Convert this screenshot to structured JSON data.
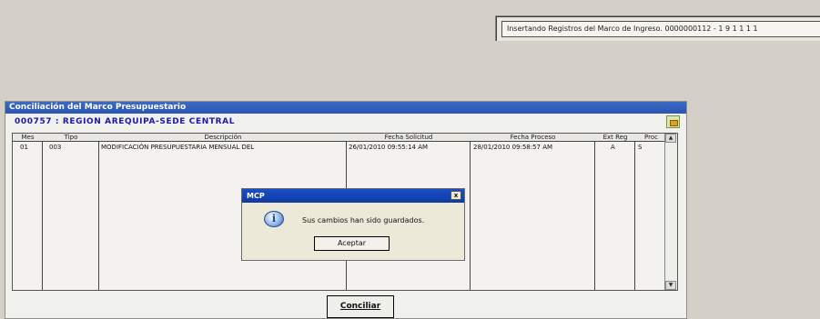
{
  "status_text": "Insertando Registros del Marco de Ingreso. 0000000112 - 1 9 1 1 1 1",
  "panel": {
    "title": "Conciliación del Marco Presupuestario",
    "region": "000757 : REGION AREQUIPA-SEDE CENTRAL"
  },
  "grid": {
    "columns": [
      "Mes",
      "Tipo",
      "Descripción",
      "Fecha Solicitud",
      "Fecha Proceso",
      "Ext Reg",
      "Proc"
    ],
    "rows": [
      [
        "01",
        "003",
        "MODIFICACIÓN PRESUPUESTARIA MENSUAL DEL",
        "26/01/2010 09:55:14 AM",
        "28/01/2010 09:58:57 AM",
        "A",
        "S"
      ]
    ]
  },
  "conciliar_label": "Conciliar",
  "dialog": {
    "title": "MCP",
    "close": "x",
    "message": "Sus cambios han sido guardados.",
    "accept_label": "Aceptar"
  },
  "icons": {
    "info": "info-icon",
    "close": "close-icon",
    "export": "export-icon"
  }
}
